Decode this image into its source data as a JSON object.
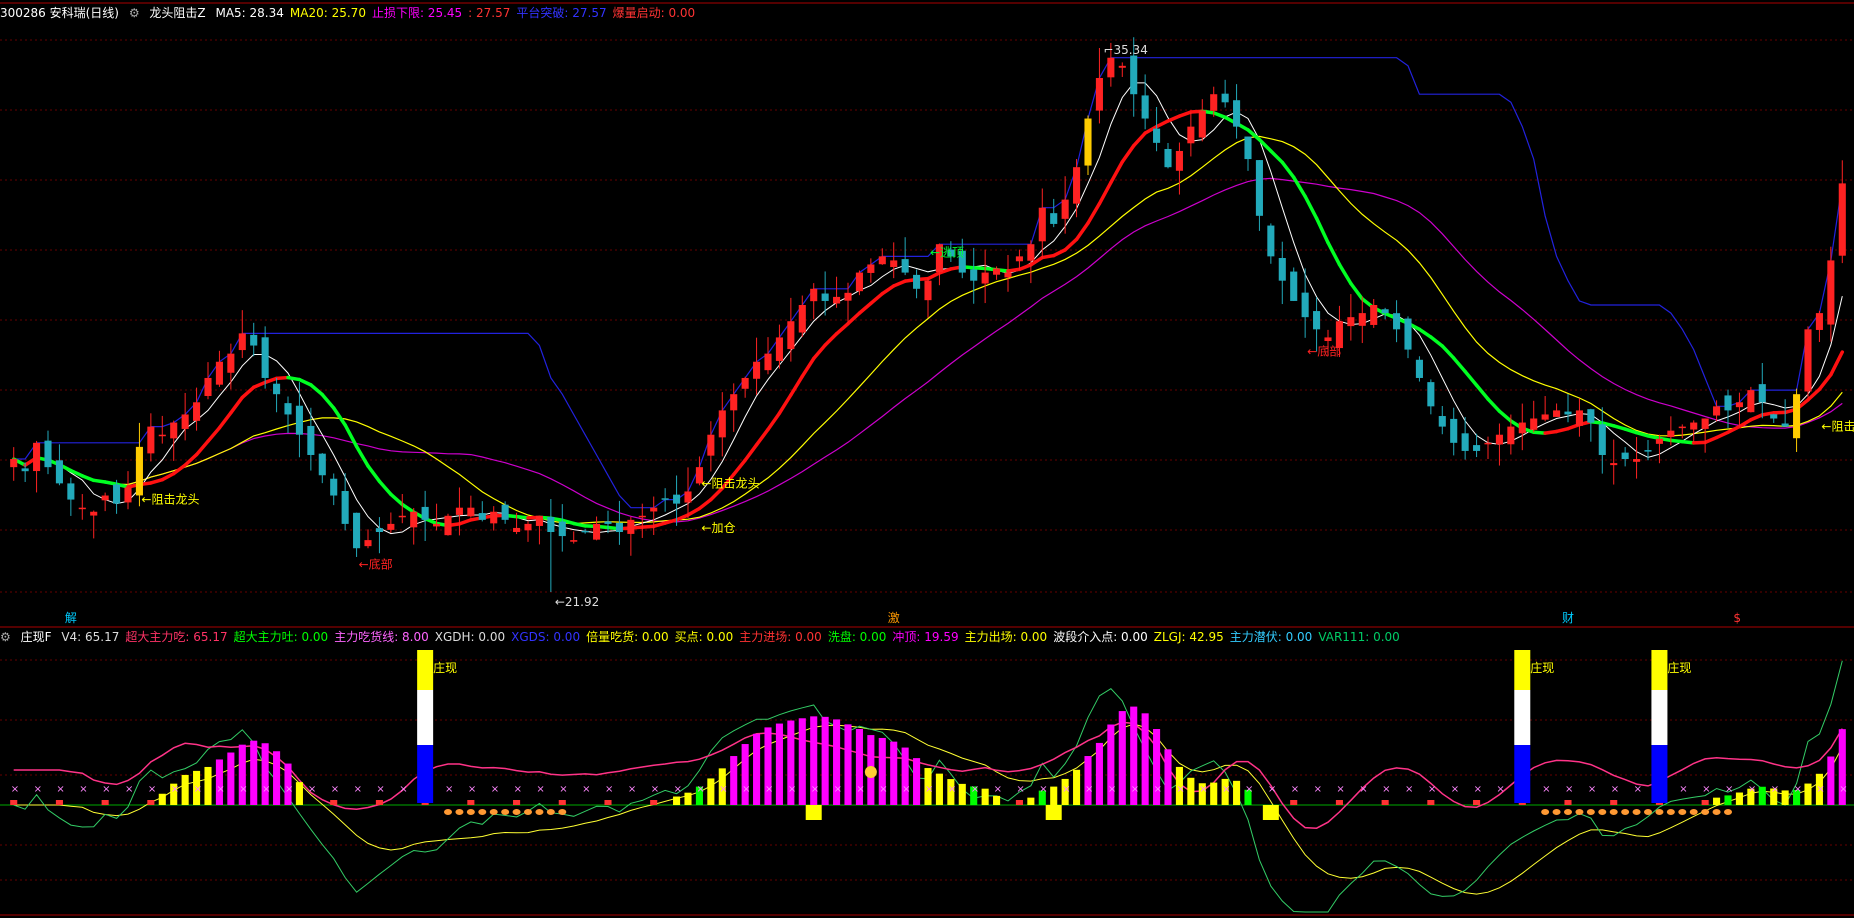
{
  "main_header": {
    "stock": "300286 安科瑞(日线)",
    "indicator": "龙头阻击Z",
    "items": [
      {
        "label": "MA5: 28.34",
        "color": "#ffffff"
      },
      {
        "label": "MA20: 25.70",
        "color": "#ffff00"
      },
      {
        "label": "止损下限: 25.45",
        "color": "#ff00ff"
      },
      {
        "label": ": 27.57",
        "color": "#ff3333"
      },
      {
        "label": "平台突破: 27.57",
        "color": "#3333ff"
      },
      {
        "label": "爆量启动: 0.00",
        "color": "#ff3333"
      }
    ]
  },
  "sub_header": {
    "indicator": "庄现F",
    "items": [
      {
        "label": "V4: 65.17",
        "color": "#dddddd"
      },
      {
        "label": "超大主力吃: 65.17",
        "color": "#ff3366"
      },
      {
        "label": "超大主力吐: 0.00",
        "color": "#00ff00"
      },
      {
        "label": "主力吃货线: 8.00",
        "color": "#ff66ff"
      },
      {
        "label": "XGDH: 0.00",
        "color": "#dddddd"
      },
      {
        "label": "XGDS: 0.00",
        "color": "#3333ff"
      },
      {
        "label": "倍量吃货: 0.00",
        "color": "#ffff00"
      },
      {
        "label": "买点: 0.00",
        "color": "#ffff00"
      },
      {
        "label": "主力进场: 0.00",
        "color": "#ff3333"
      },
      {
        "label": "洗盘: 0.00",
        "color": "#00ff00"
      },
      {
        "label": "冲顶: 19.59",
        "color": "#ff00ff"
      },
      {
        "label": "主力出场: 0.00",
        "color": "#ffff00"
      },
      {
        "label": "波段介入点: 0.00",
        "color": "#ffffff"
      },
      {
        "label": "ZLGJ: 42.95",
        "color": "#ffff00"
      },
      {
        "label": "主力潜伏: 0.00",
        "color": "#33ccff"
      },
      {
        "label": "VAR111: 0.00",
        "color": "#00cc66"
      }
    ]
  },
  "annotations": {
    "high_price": "35.34",
    "low_price": "21.92",
    "snipe1": "阻击龙头",
    "snipe2": "阻击龙头",
    "snipe3": "阻击龙头",
    "bottom1": "底部",
    "bottom2": "底部",
    "add": "加仓",
    "escape": "逃顶",
    "zx": "庄现",
    "events": [
      "解",
      "激",
      "财",
      "$"
    ]
  },
  "colors": {
    "up": "#ff2222",
    "down": "#22aabb",
    "yang_marker": "#ffcc00",
    "grid": "#660000",
    "ma5": "#ffffff",
    "ma20": "#ffff00",
    "stop": "#cc00cc",
    "platform": "#2222dd",
    "signal_green": "#00ff22",
    "signal_red": "#ff1111"
  },
  "chart_data": {
    "type": "candlestick",
    "title": "300286 安科瑞(日线)",
    "price_high": 35.34,
    "price_low": 21.92,
    "close": [
      25.2,
      24.9,
      25.6,
      25.0,
      24.6,
      24.2,
      24.0,
      23.9,
      24.3,
      24.1,
      24.5,
      25.5,
      26.0,
      25.8,
      26.1,
      26.3,
      26.6,
      27.2,
      27.6,
      27.8,
      28.3,
      28.0,
      27.2,
      26.8,
      26.3,
      25.8,
      25.3,
      24.8,
      24.3,
      23.6,
      23.0,
      23.2,
      23.4,
      23.6,
      23.8,
      23.9,
      23.7,
      23.6,
      23.8,
      24.0,
      24.0,
      23.7,
      23.9,
      23.7,
      23.5,
      23.6,
      23.8,
      23.4,
      23.3,
      23.2,
      23.4,
      23.6,
      23.6,
      23.4,
      23.7,
      23.8,
      24.0,
      24.2,
      24.1,
      24.4,
      25.0,
      25.8,
      26.4,
      26.8,
      27.2,
      27.6,
      27.8,
      28.2,
      28.6,
      29.0,
      29.4,
      29.1,
      29.2,
      29.3,
      29.8,
      30.0,
      30.2,
      30.1,
      29.8,
      29.4,
      29.6,
      30.5,
      30.2,
      29.8,
      29.6,
      29.8,
      29.9,
      29.8,
      30.2,
      30.5,
      31.4,
      31.0,
      31.6,
      32.4,
      33.6,
      34.6,
      35.1,
      34.9,
      34.2,
      33.6,
      33.0,
      32.4,
      32.8,
      33.4,
      33.8,
      34.2,
      34.0,
      33.4,
      32.6,
      31.2,
      30.2,
      29.6,
      29.1,
      28.7,
      28.4,
      28.2,
      28.6,
      28.7,
      28.8,
      29.0,
      28.8,
      28.4,
      27.9,
      27.2,
      26.5,
      26.0,
      25.6,
      25.4,
      25.4,
      25.6,
      25.8,
      26.0,
      26.1,
      26.2,
      26.3,
      26.4,
      26.3,
      26.4,
      26.1,
      25.3,
      25.1,
      25.2,
      25.2,
      25.4,
      25.7,
      25.9,
      26.0,
      26.1,
      26.2,
      26.5,
      26.4,
      26.6,
      26.9,
      26.6,
      26.2,
      26.0,
      26.8,
      28.4,
      28.8,
      30.1,
      32.0
    ]
  }
}
